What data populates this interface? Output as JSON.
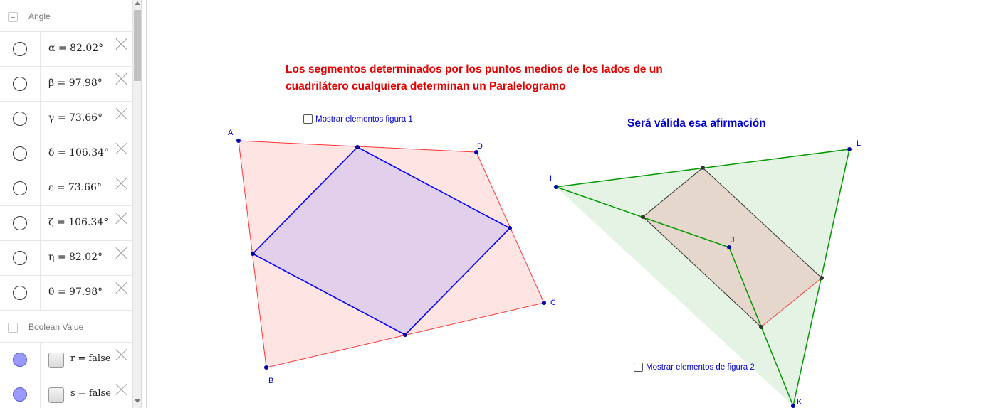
{
  "algebra": {
    "groups": [
      {
        "label": "Angle",
        "items": [
          {
            "text": "α = 82.02°"
          },
          {
            "text": "β = 97.98°"
          },
          {
            "text": "γ = 73.66°"
          },
          {
            "text": "δ = 106.34°"
          },
          {
            "text": "ε = 73.66°"
          },
          {
            "text": "ζ = 106.34°"
          },
          {
            "text": "η = 82.02°"
          },
          {
            "text": "θ = 97.98°"
          }
        ]
      },
      {
        "label": "Boolean Value",
        "items": [
          {
            "text": "r = false"
          },
          {
            "text": "s = false"
          }
        ]
      }
    ]
  },
  "graphics": {
    "title_red": "Los segmentos determinados por los puntos medios de los lados de un cuadrilátero cualquiera determinan un Paralelogramo",
    "title_blue": "Será válida esa afirmación",
    "checkbox1_label": "Mostrar elementos figura 1",
    "checkbox2_label": "Mostrar elementos de figura 2",
    "points": {
      "A": "A",
      "B": "B",
      "C": "C",
      "D": "D",
      "I": "I",
      "J": "J",
      "K": "K",
      "L": "L"
    },
    "colors": {
      "red_title": "#e60000",
      "blue_text": "#0000cc",
      "quad_fill": "#ffe0e0",
      "quad_stroke": "#ff3333",
      "inner_stroke": "#0000ff",
      "inner_fill": "#d8c8ee",
      "green_stroke": "#009900",
      "green_fill": "#e0f2e0"
    }
  }
}
